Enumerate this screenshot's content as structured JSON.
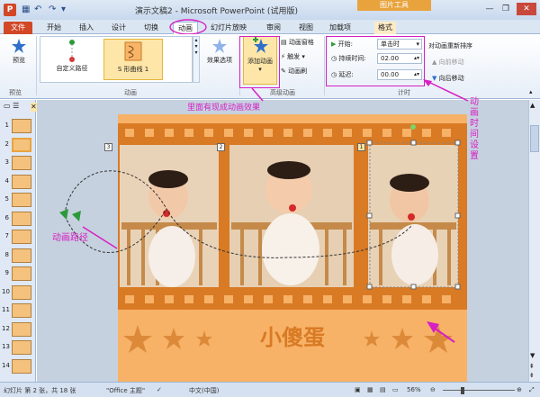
{
  "titlebar": {
    "title": "演示文稿2 - Microsoft PowerPoint (试用版)",
    "context_tool": "图片工具",
    "app_letter": "P",
    "qat": [
      "▦",
      "↶",
      "↷",
      "▾"
    ],
    "win": [
      "—",
      "❐",
      "✕"
    ]
  },
  "tabs": [
    {
      "label": "文件"
    },
    {
      "label": "开始"
    },
    {
      "label": "插入"
    },
    {
      "label": "设计"
    },
    {
      "label": "切换"
    },
    {
      "label": "动画"
    },
    {
      "label": "幻灯片放映"
    },
    {
      "label": "审阅"
    },
    {
      "label": "视图"
    },
    {
      "label": "加载项"
    },
    {
      "label": "格式"
    }
  ],
  "ribbon": {
    "preview": "预览",
    "preview_group": "预览",
    "gallery": [
      {
        "label": "自定义路径"
      },
      {
        "label": "S 形曲线 1"
      }
    ],
    "anim_group": "动画",
    "effect_options": "效果选项",
    "add_animation": "添加动画",
    "anim_pane": "动画窗格",
    "trigger": "触发",
    "anim_painter": "动画刷",
    "advanced_group": "高级动画",
    "start_label": "开始:",
    "start_value": "单击时",
    "duration_label": "持续时间:",
    "duration_value": "02.00",
    "delay_label": "延迟:",
    "delay_value": "00.00",
    "timing_group": "计时",
    "reorder": "对动画重新排序",
    "move_earlier": "向前移动",
    "move_later": "向后移动"
  },
  "annotations": {
    "effects": "里面有现成动画效果",
    "path": "动画路径",
    "timing": "动画时间设置"
  },
  "slide": {
    "title": "小傻蛋",
    "tag1": "1",
    "tag2": "2",
    "tag3": "3"
  },
  "thumbs": [
    "1",
    "2",
    "3",
    "4",
    "5",
    "6",
    "7",
    "8",
    "9",
    "10",
    "11",
    "12",
    "13",
    "14"
  ],
  "status": {
    "slide_info": "幻灯片 第 2 张，共 18 张",
    "theme": "\"Office 主题\"",
    "lang": "中文(中国)",
    "zoom": "56%"
  },
  "colors": {
    "file_tab": "#d24726",
    "context": "#e8a33d",
    "annotation": "#d61fc4",
    "slide_bg": "#f7b267"
  }
}
